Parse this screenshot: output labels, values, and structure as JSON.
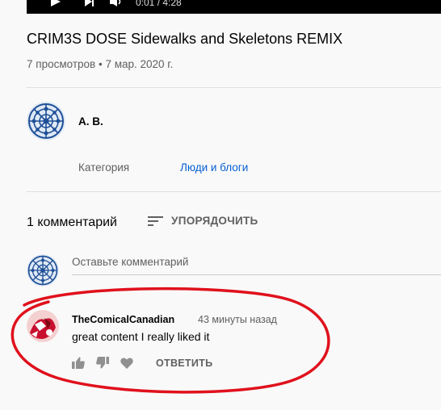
{
  "player": {
    "time_display": "0:01 / 4:28"
  },
  "video": {
    "title": "CRIM3S DOSE Sidewalks and Skeletons REMIX",
    "views": "7 просмотров",
    "separator": "•",
    "date": "7 мар. 2020 г."
  },
  "channel": {
    "name": "A. B.",
    "avatar_icon": "mandala-avatar-icon"
  },
  "details": {
    "category_label": "Категория",
    "category_value": "Люди и блоги",
    "link_color": "#065fd4"
  },
  "comments": {
    "count_label": "1 комментарий",
    "sort_label": "УПОРЯДОЧИТЬ",
    "add_placeholder": "Оставьте комментарий",
    "items": [
      {
        "author": "TheComicalCanadian",
        "time": "43 минуты назад",
        "text": "great content I really liked it",
        "reply_label": "ОТВЕТИТЬ"
      }
    ]
  },
  "annotation": {
    "color": "#e0111c",
    "shape": "hand-drawn-ellipse"
  }
}
